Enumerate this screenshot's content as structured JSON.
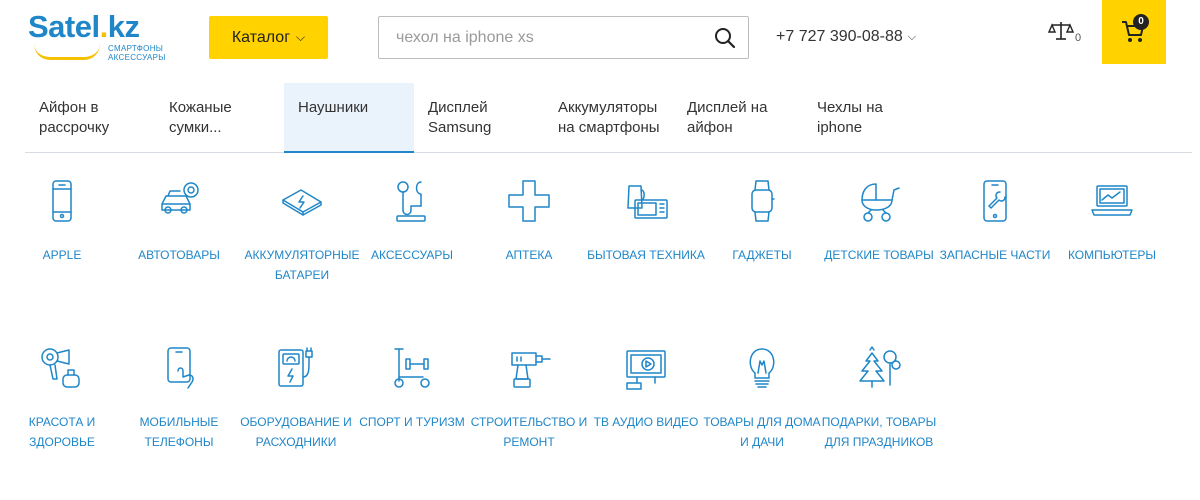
{
  "header": {
    "logo_text_main": "Satel",
    "logo_text_dot": ".",
    "logo_text_kz": "kz",
    "logo_sub_line1": "смартфоны",
    "logo_sub_line2": "аксессуары",
    "catalog_label": "Каталог",
    "search_placeholder": "чехол на iphone xs",
    "phone": "+7 727 390-08-88",
    "compare_count": "0",
    "cart_count": "0",
    "accent_color": "#ffd200",
    "brand_color": "#1f86c8"
  },
  "tabs": [
    {
      "label": "Айфон в рассрочку",
      "active": false
    },
    {
      "label": "Кожаные сумки...",
      "active": false
    },
    {
      "label": "Наушники",
      "active": true
    },
    {
      "label": "Дисплей Samsung",
      "active": false
    },
    {
      "label": "Аккумуляторы на смартфоны",
      "active": false
    },
    {
      "label": "Дисплей на айфон",
      "active": false
    },
    {
      "label": "Чехлы на iphone",
      "active": false
    }
  ],
  "categories": [
    {
      "label": "Apple",
      "icon": "smartphone-icon"
    },
    {
      "label": "Автотовары",
      "icon": "car-icon"
    },
    {
      "label": "Аккумуляторные батареи",
      "icon": "battery-icon"
    },
    {
      "label": "Аксессуары",
      "icon": "headphones-icon"
    },
    {
      "label": "Аптека",
      "icon": "medical-cross-icon"
    },
    {
      "label": "Бытовая техника",
      "icon": "appliances-icon"
    },
    {
      "label": "Гаджеты",
      "icon": "smartwatch-icon"
    },
    {
      "label": "Детские товары",
      "icon": "stroller-icon"
    },
    {
      "label": "Запасные части",
      "icon": "repair-phone-icon"
    },
    {
      "label": "Компьютеры",
      "icon": "laptop-icon"
    },
    {
      "label": "Красота и здоровье",
      "icon": "hairdryer-icon"
    },
    {
      "label": "Мобильные телефоны",
      "icon": "phone-hand-icon"
    },
    {
      "label": "Оборудование и расходники",
      "icon": "charger-icon"
    },
    {
      "label": "Спорт и туризм",
      "icon": "scooter-icon"
    },
    {
      "label": "Строительство и ремонт",
      "icon": "drill-icon"
    },
    {
      "label": "ТВ Аудио Видео",
      "icon": "tv-icon"
    },
    {
      "label": "Товары для дома и дачи",
      "icon": "lightbulb-icon"
    },
    {
      "label": "Подарки, товары для праздников",
      "icon": "christmas-tree-icon"
    }
  ]
}
